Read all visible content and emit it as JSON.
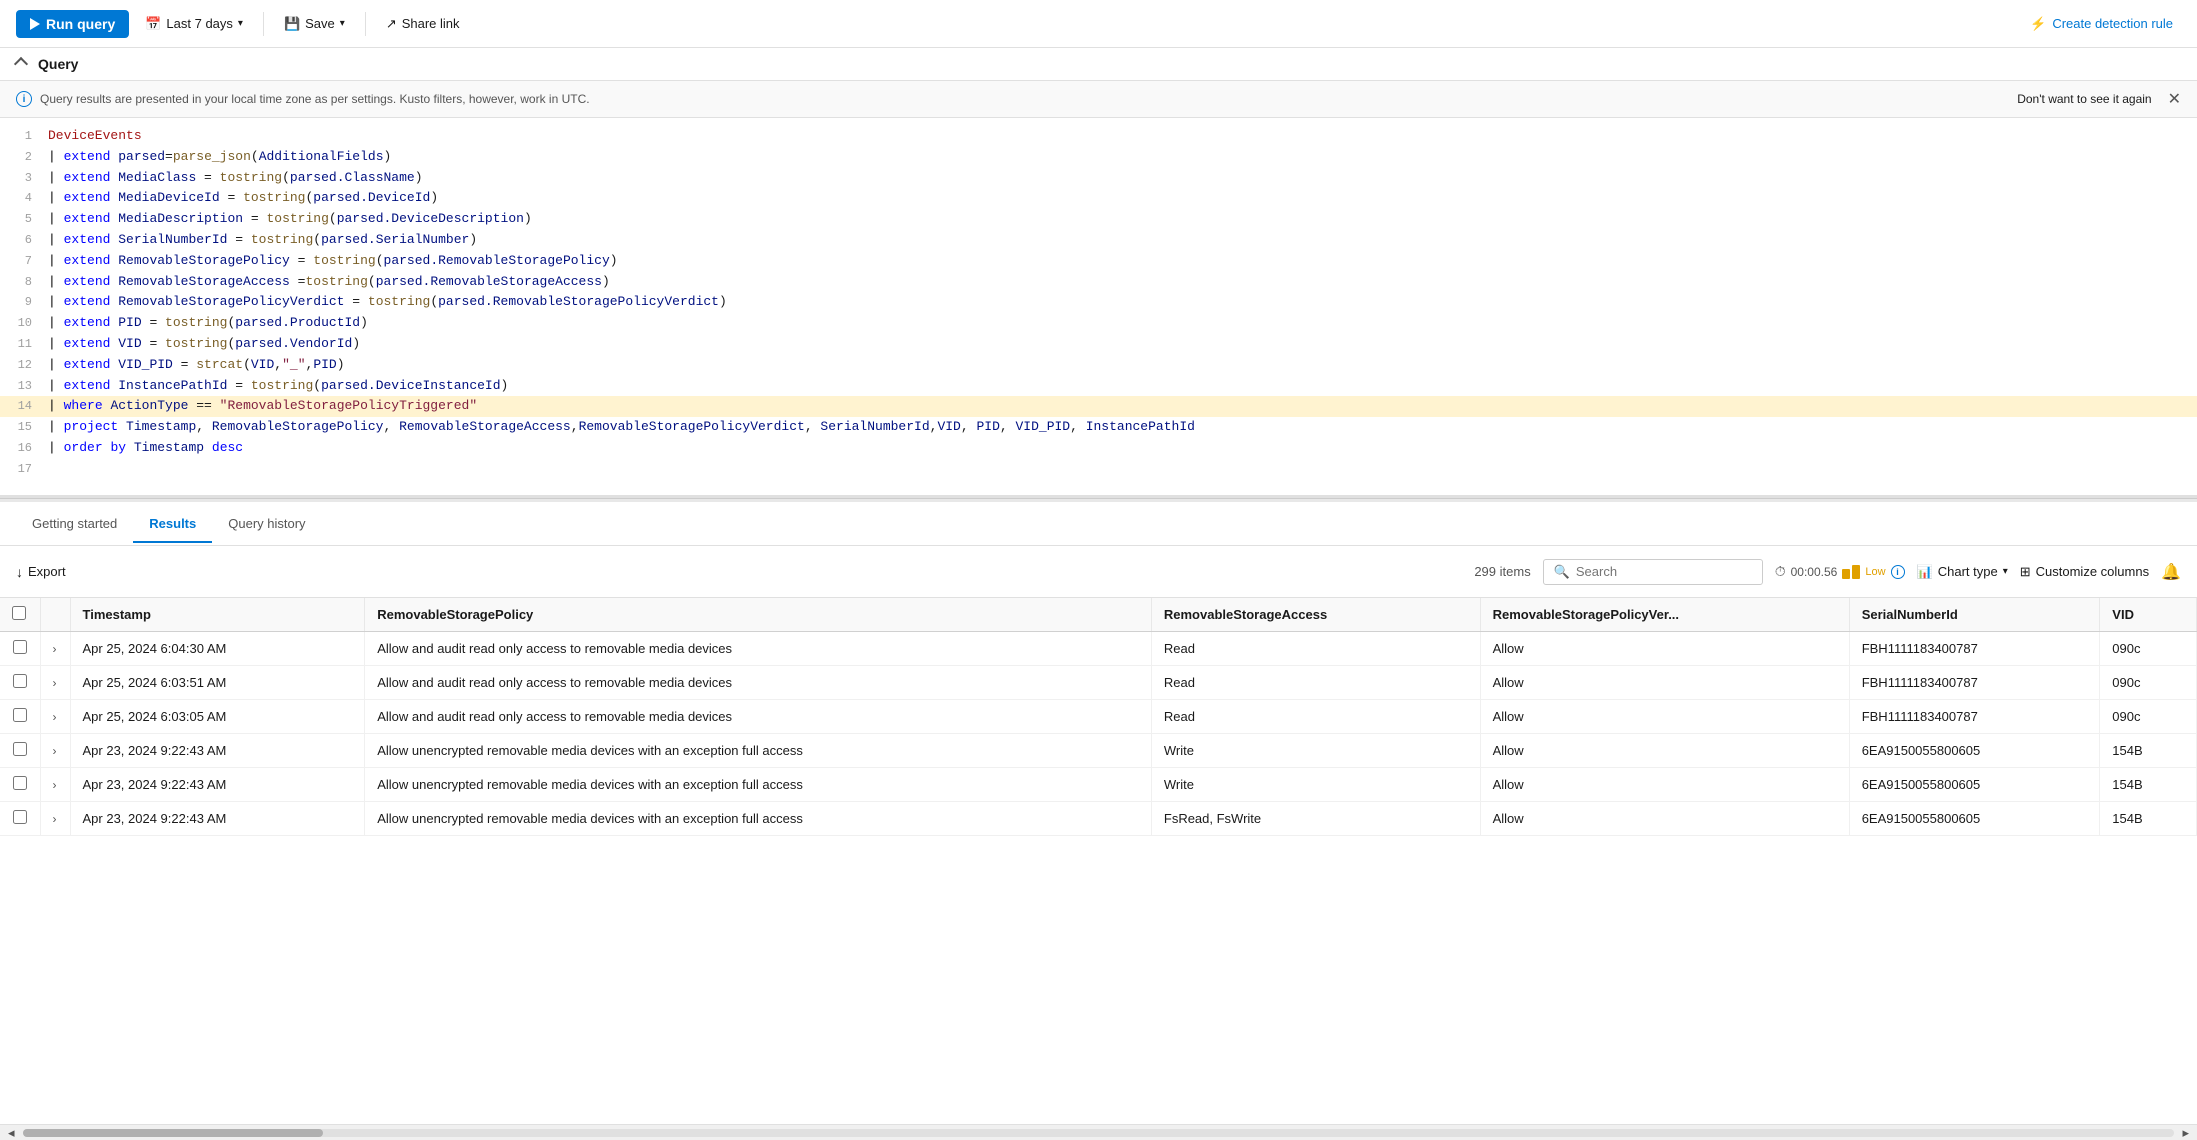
{
  "toolbar": {
    "run_label": "Run query",
    "time_range": "Last 7 days",
    "save_label": "Save",
    "share_label": "Share link",
    "create_rule_label": "Create detection rule"
  },
  "query_section": {
    "title": "Query",
    "info_text": "Query results are presented in your local time zone as per settings. Kusto filters, however, work in UTC.",
    "dont_show_label": "Don't want to see it again"
  },
  "code_lines": [
    {
      "num": "1",
      "content": "DeviceEvents"
    },
    {
      "num": "2",
      "content": "| extend parsed=parse_json(AdditionalFields)"
    },
    {
      "num": "3",
      "content": "| extend MediaClass = tostring(parsed.ClassName)"
    },
    {
      "num": "4",
      "content": "| extend MediaDeviceId = tostring(parsed.DeviceId)"
    },
    {
      "num": "5",
      "content": "| extend MediaDescription = tostring(parsed.DeviceDescription)"
    },
    {
      "num": "6",
      "content": "| extend SerialNumberId = tostring(parsed.SerialNumber)"
    },
    {
      "num": "7",
      "content": "| extend RemovableStoragePolicy = tostring(parsed.RemovableStoragePolicy)"
    },
    {
      "num": "8",
      "content": "| extend RemovableStorageAccess =tostring(parsed.RemovableStorageAccess)"
    },
    {
      "num": "9",
      "content": "| extend RemovableStoragePolicyVerdict = tostring(parsed.RemovableStoragePolicyVerdict)"
    },
    {
      "num": "10",
      "content": "| extend PID = tostring(parsed.ProductId)"
    },
    {
      "num": "11",
      "content": "| extend VID = tostring(parsed.VendorId)"
    },
    {
      "num": "12",
      "content": "| extend VID_PID = strcat(VID,\"_\",PID)"
    },
    {
      "num": "13",
      "content": "| extend InstancePathId = tostring(parsed.DeviceInstanceId)"
    },
    {
      "num": "14",
      "content": "| where ActionType == \"RemovableStoragePolicyTriggered\""
    },
    {
      "num": "15",
      "content": "| project Timestamp, RemovableStoragePolicy, RemovableStorageAccess,RemovableStoragePolicyVerdict, SerialNumberId,VID, PID, VID_PID, InstancePathId"
    },
    {
      "num": "16",
      "content": "| order by Timestamp desc"
    },
    {
      "num": "17",
      "content": ""
    }
  ],
  "tabs": {
    "items": [
      {
        "id": "getting-started",
        "label": "Getting started"
      },
      {
        "id": "results",
        "label": "Results"
      },
      {
        "id": "query-history",
        "label": "Query history"
      }
    ],
    "active": "results"
  },
  "results_toolbar": {
    "export_label": "Export",
    "item_count": "299 items",
    "search_placeholder": "Search",
    "timing": "00:00.56",
    "perf_label": "Low",
    "chart_type_label": "Chart type",
    "customize_label": "Customize columns"
  },
  "table": {
    "columns": [
      {
        "id": "check",
        "label": ""
      },
      {
        "id": "expand",
        "label": ""
      },
      {
        "id": "timestamp",
        "label": "Timestamp"
      },
      {
        "id": "removableStoragePolicy",
        "label": "RemovableStoragePolicy"
      },
      {
        "id": "removableStorageAccess",
        "label": "RemovableStorageAccess"
      },
      {
        "id": "removableStoragePolicyVer",
        "label": "RemovableStoragePolicyVer..."
      },
      {
        "id": "serialNumberId",
        "label": "SerialNumberId"
      },
      {
        "id": "vid",
        "label": "VID"
      }
    ],
    "rows": [
      {
        "timestamp": "Apr 25, 2024 6:04:30 AM",
        "policy": "Allow and audit read only access to removable media devices",
        "access": "Read",
        "verdict": "Allow",
        "serial": "FBH1111183400787",
        "vid": "090c"
      },
      {
        "timestamp": "Apr 25, 2024 6:03:51 AM",
        "policy": "Allow and audit read only access to removable media devices",
        "access": "Read",
        "verdict": "Allow",
        "serial": "FBH1111183400787",
        "vid": "090c"
      },
      {
        "timestamp": "Apr 25, 2024 6:03:05 AM",
        "policy": "Allow and audit read only access to removable media devices",
        "access": "Read",
        "verdict": "Allow",
        "serial": "FBH1111183400787",
        "vid": "090c"
      },
      {
        "timestamp": "Apr 23, 2024 9:22:43 AM",
        "policy": "Allow unencrypted removable media devices with an exception full access",
        "access": "Write",
        "verdict": "Allow",
        "serial": "6EA9150055800605",
        "vid": "154B"
      },
      {
        "timestamp": "Apr 23, 2024 9:22:43 AM",
        "policy": "Allow unencrypted removable media devices with an exception full access",
        "access": "Write",
        "verdict": "Allow",
        "serial": "6EA9150055800605",
        "vid": "154B"
      },
      {
        "timestamp": "Apr 23, 2024 9:22:43 AM",
        "policy": "Allow unencrypted removable media devices with an exception full access",
        "access": "FsRead, FsWrite",
        "verdict": "Allow",
        "serial": "6EA9150055800605",
        "vid": "154B"
      }
    ]
  }
}
